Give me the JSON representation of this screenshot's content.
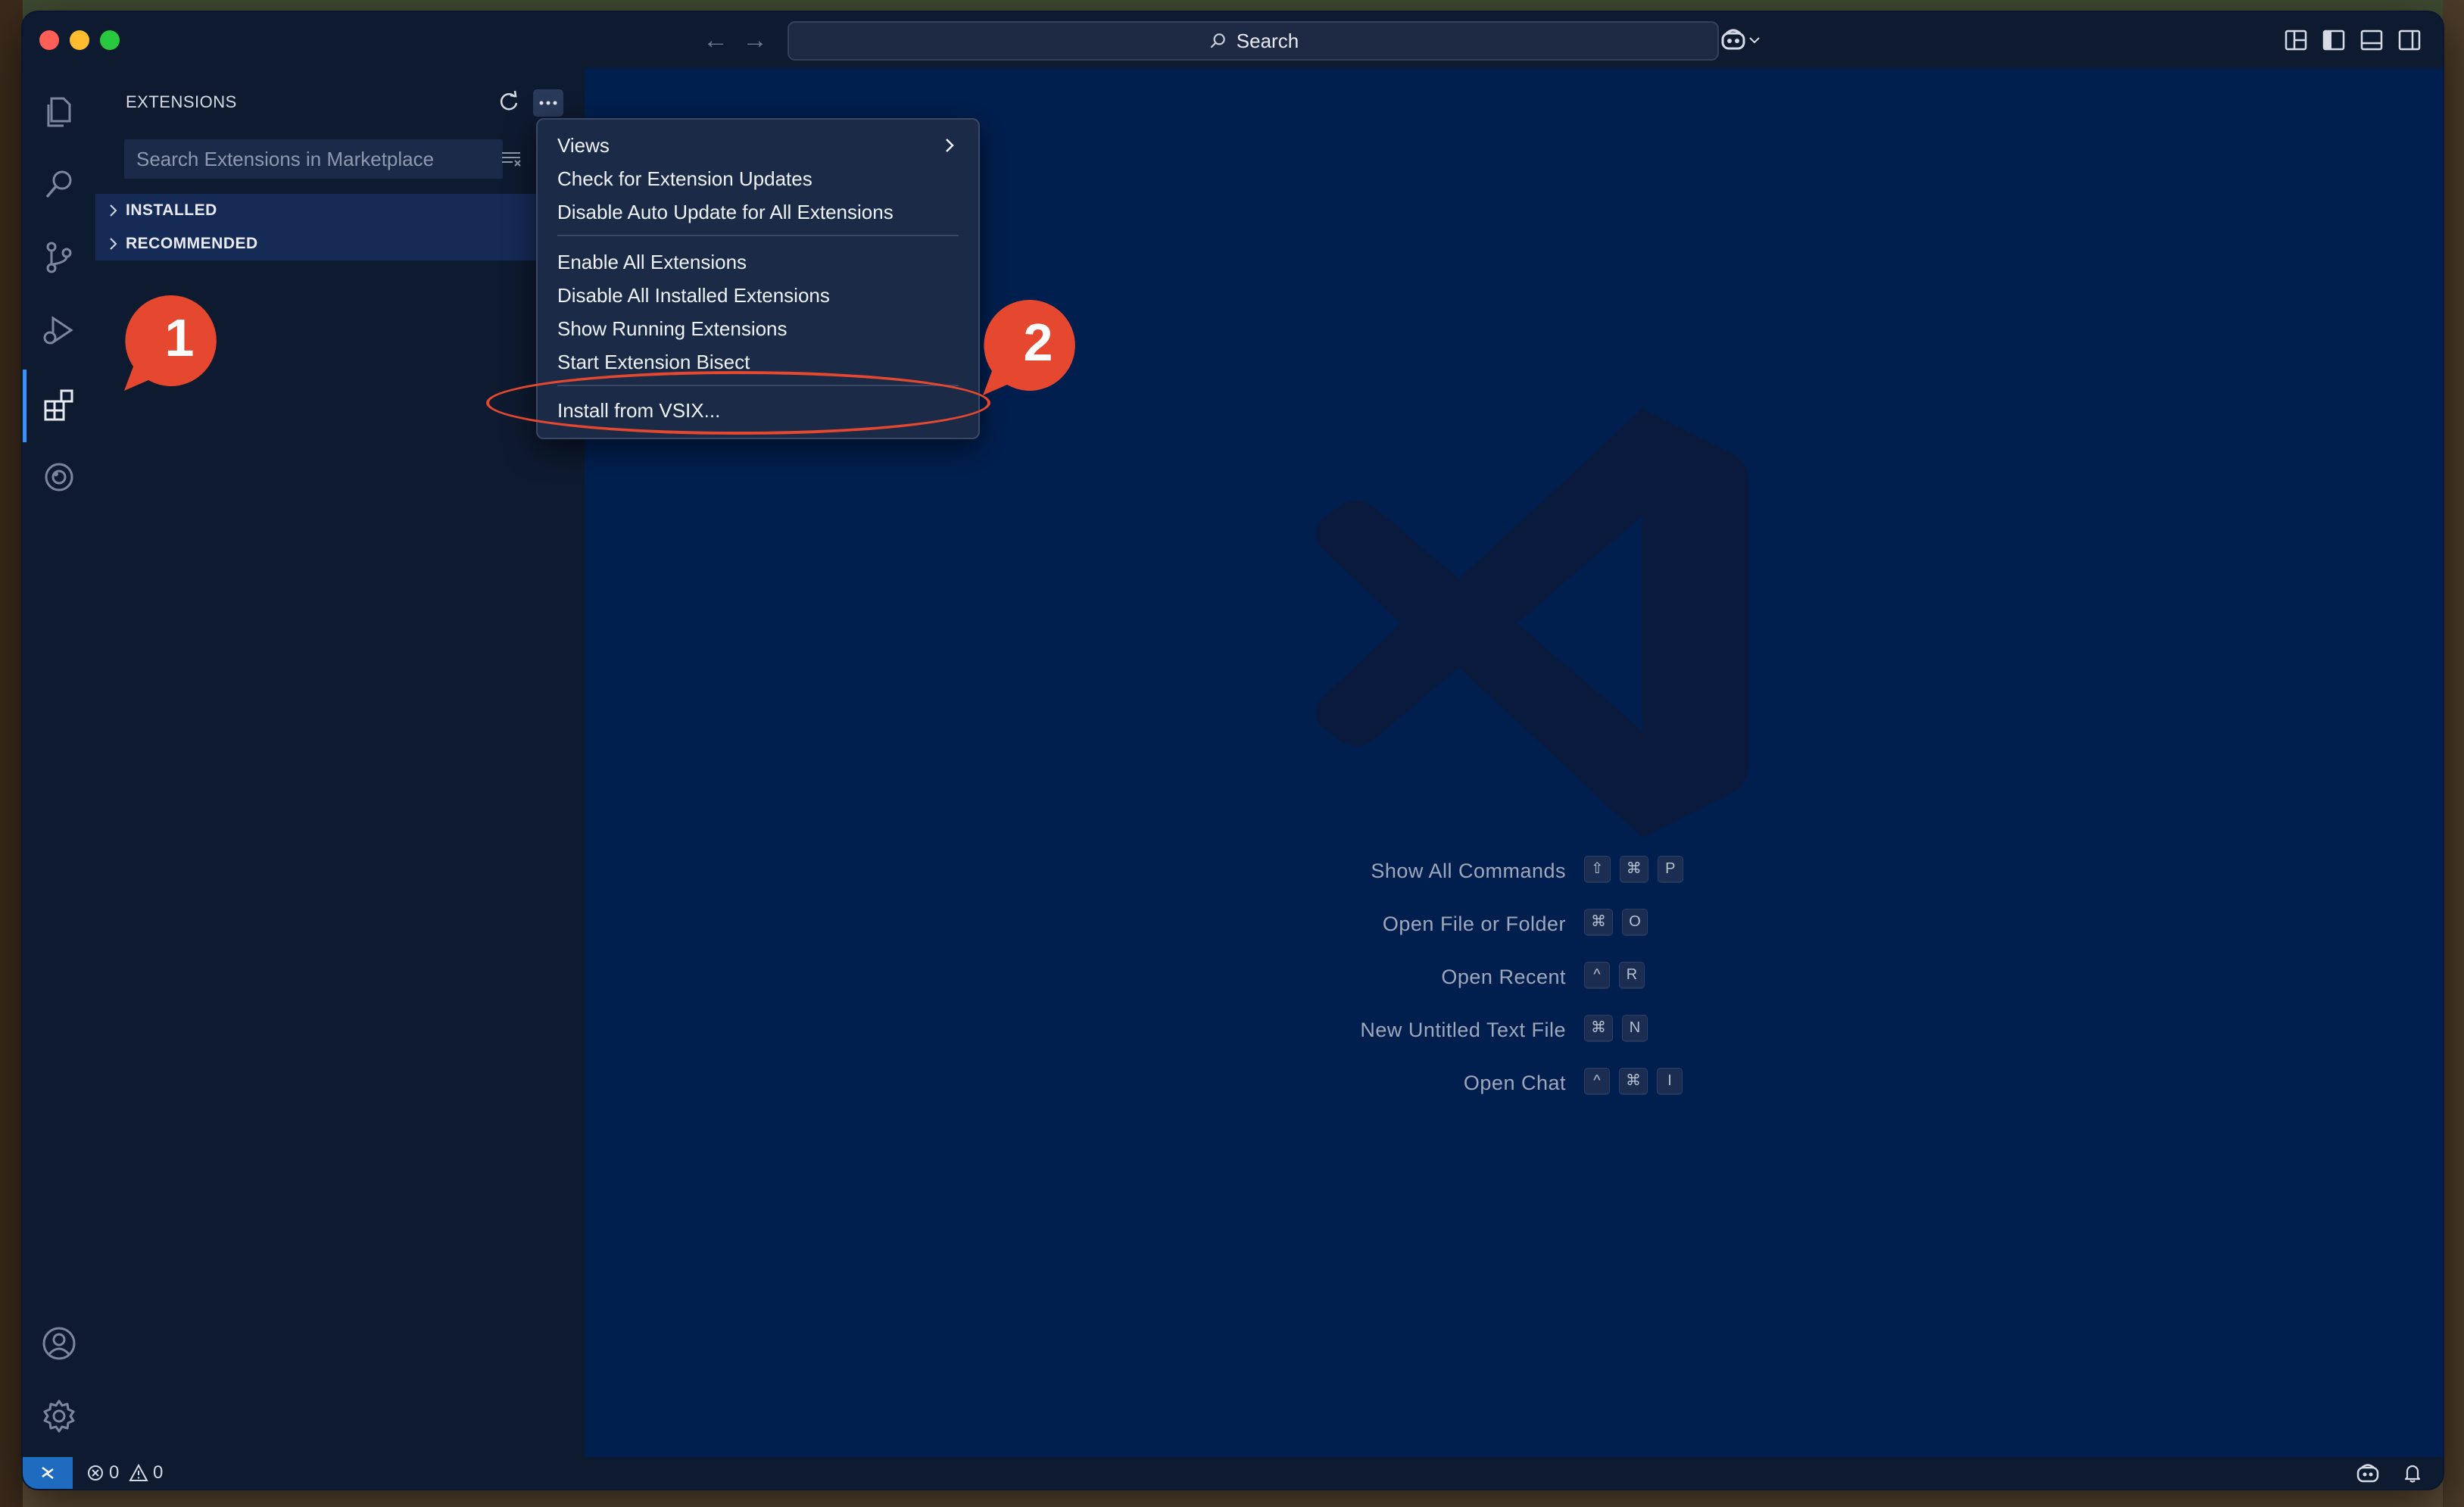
{
  "titlebar": {
    "search_label": "Search",
    "traffic_lights": {
      "close": "#ff5f57",
      "minimize": "#febc2e",
      "zoom": "#28c840"
    }
  },
  "activity_bar": {
    "icons": [
      "files-icon",
      "search-icon",
      "source-control-icon",
      "run-debug-icon",
      "extensions-icon",
      "remote-explorer-icon",
      "account-icon",
      "settings-gear-icon"
    ],
    "active": "extensions-icon"
  },
  "sidebar": {
    "title": "EXTENSIONS",
    "search_placeholder": "Search Extensions in Marketplace",
    "sections": [
      {
        "label": "INSTALLED"
      },
      {
        "label": "RECOMMENDED"
      }
    ]
  },
  "context_menu": {
    "items": [
      "Views",
      "Check for Extension Updates",
      "Disable Auto Update for All Extensions",
      "Enable All Extensions",
      "Disable All Installed Extensions",
      "Show Running Extensions",
      "Start Extension Bisect",
      "Install from VSIX..."
    ]
  },
  "welcome": {
    "shortcuts": [
      {
        "label": "Show All Commands",
        "keys": [
          "⇧",
          "⌘",
          "P"
        ]
      },
      {
        "label": "Open File or Folder",
        "keys": [
          "⌘",
          "O"
        ]
      },
      {
        "label": "Open Recent",
        "keys": [
          "^",
          "R"
        ]
      },
      {
        "label": "New Untitled Text File",
        "keys": [
          "⌘",
          "N"
        ]
      },
      {
        "label": "Open Chat",
        "keys": [
          "^",
          "⌘",
          "I"
        ]
      }
    ]
  },
  "status_bar": {
    "errors": "0",
    "warnings": "0"
  },
  "annotations": {
    "badge1": "1",
    "badge2": "2",
    "color": "#e5482e"
  }
}
